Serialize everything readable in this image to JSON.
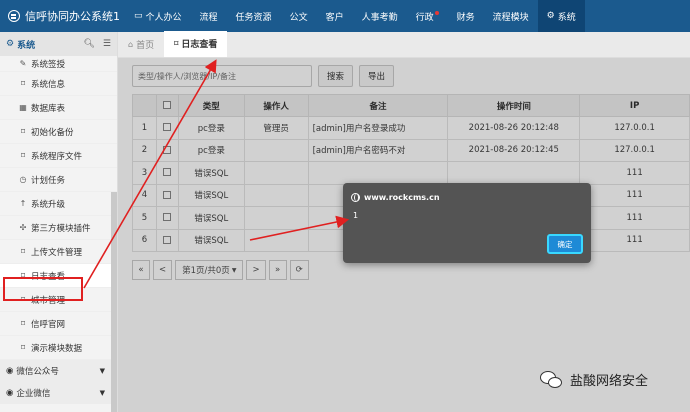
{
  "app": {
    "title": "信呼协同办公系统1"
  },
  "nav": [
    {
      "label": "个人办公",
      "icon": "monitor-icon"
    },
    {
      "label": "流程"
    },
    {
      "label": "任务资源"
    },
    {
      "label": "公文"
    },
    {
      "label": "客户"
    },
    {
      "label": "人事考勤"
    },
    {
      "label": "行政",
      "badge_color": "#e53935"
    },
    {
      "label": "财务"
    },
    {
      "label": "流程模块"
    },
    {
      "label": "系统",
      "icon": "gear-icon",
      "active": true
    }
  ],
  "sidebar": {
    "header": "系统",
    "items": [
      {
        "label": "系统签授",
        "icon": "pencil-icon"
      },
      {
        "label": "系统信息",
        "icon": "bookmark-icon"
      },
      {
        "label": "数据库表",
        "icon": "table-icon"
      },
      {
        "label": "初始化备份",
        "icon": "bookmark-icon"
      },
      {
        "label": "系统程序文件",
        "icon": "bookmark-icon"
      },
      {
        "label": "计划任务",
        "icon": "clock-icon"
      },
      {
        "label": "系统升级",
        "icon": "arrow-up-icon"
      },
      {
        "label": "第三方模块插件",
        "icon": "puzzle-icon"
      },
      {
        "label": "上传文件管理",
        "icon": "bookmark-icon"
      },
      {
        "label": "日志查看",
        "icon": "bookmark-icon",
        "selected": true
      },
      {
        "label": "城市管理",
        "icon": "bookmark-icon"
      },
      {
        "label": "信呼官网",
        "icon": "bookmark-icon"
      },
      {
        "label": "演示模块数据",
        "icon": "bookmark-icon"
      }
    ],
    "groups": [
      {
        "label": "微信公众号"
      },
      {
        "label": "企业微信"
      }
    ]
  },
  "tabs": [
    {
      "label": "首页",
      "icon": "home-icon"
    },
    {
      "label": "日志查看",
      "icon": "bookmark-icon",
      "active": true
    }
  ],
  "toolbar": {
    "search_placeholder": "类型/操作人/浏览器/IP/备注",
    "search_label": "搜索",
    "export_label": "导出"
  },
  "table": {
    "columns": [
      "",
      "",
      "类型",
      "操作人",
      "备注",
      "操作时间",
      "IP"
    ],
    "rows": [
      [
        "1",
        "pc登录",
        "管理员",
        "[admin]用户名登录成功",
        "2021-08-26 20:12:48",
        "127.0.0.1"
      ],
      [
        "2",
        "pc登录",
        "",
        "[admin]用户名密码不对",
        "2021-08-26 20:12:45",
        "127.0.0.1"
      ],
      [
        "3",
        "错误SQL",
        "",
        "",
        "",
        "111"
      ],
      [
        "4",
        "错误SQL",
        "",
        "",
        "",
        "111"
      ],
      [
        "5",
        "错误SQL",
        "",
        "",
        "",
        "111"
      ],
      [
        "6",
        "错误SQL",
        "",
        "",
        "",
        "111"
      ]
    ]
  },
  "pager": {
    "first": "«",
    "prev": "<",
    "page_info": "第1页/共0页",
    "next": ">",
    "last": "»"
  },
  "dialog": {
    "title": "www.rockcms.cn",
    "message": "1",
    "ok_label": "确定"
  },
  "watermark": {
    "text": "盐酸网络安全"
  },
  "colors": {
    "topbar": "#1b5a8e",
    "annotation": "#e02020",
    "dialog_bg": "#545454",
    "ok_button": "#1e8ad6"
  }
}
